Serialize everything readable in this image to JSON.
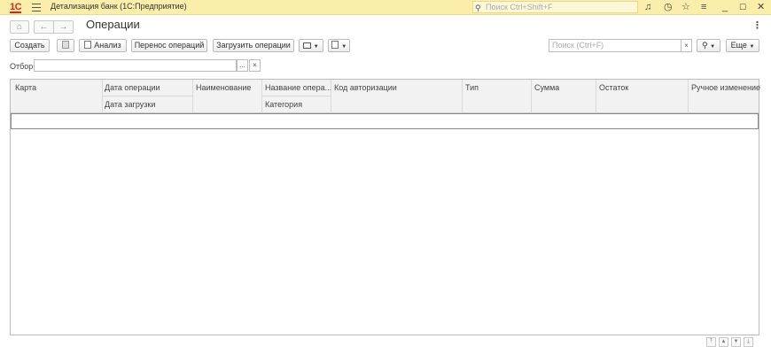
{
  "titlebar": {
    "logo": "1С",
    "app_title": "Детализация банк  (1С:Предприятие)",
    "search_placeholder": "Поиск Ctrl+Shift+F"
  },
  "nav": {
    "home_glyph": "⌂",
    "back_glyph": "←",
    "forward_glyph": "→",
    "page_title": "Операции",
    "more_glyph": "⋮"
  },
  "toolbar": {
    "create_label": "Создать",
    "analysis_label": "Анализ",
    "transfer_label": "Перенос операций",
    "load_label": "Загрузить операции",
    "search_placeholder": "Поиск (Ctrl+F)",
    "clear_glyph": "×",
    "more_label": "Еще"
  },
  "filter": {
    "label": "Отбор:",
    "choose_glyph": "...",
    "clear_glyph": "×"
  },
  "table": {
    "headers": {
      "card": "Карта",
      "op_date": "Дата операции",
      "load_date": "Дата загрузки",
      "name": "Наименование",
      "op_name": "Название опера...",
      "category": "Категория",
      "auth_code": "Код авторизации",
      "type": "Тип",
      "sum": "Сумма",
      "balance": "Остаток",
      "manual": "Ручное изменение"
    }
  },
  "scroll": {
    "top": "⤒",
    "up": "▲",
    "down": "▼",
    "bottom": "⤓"
  }
}
